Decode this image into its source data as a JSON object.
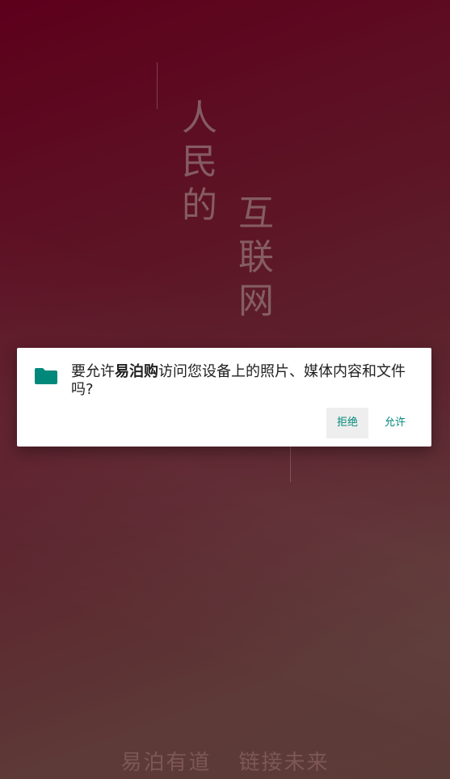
{
  "splash": {
    "vertical_col1": "人民的",
    "vertical_col2": "互联网",
    "slogan_left": "易泊有道",
    "slogan_right": "链接未来"
  },
  "dialog": {
    "icon": "folder-icon",
    "message_prefix": "要允许",
    "app_name": "易泊购",
    "message_suffix": "访问您设备上的照片、媒体内容和文件吗?",
    "deny_label": "拒绝",
    "allow_label": "允许"
  },
  "colors": {
    "accent": "#00897b",
    "background_top": "#6a0020",
    "background_bottom": "#68443f"
  }
}
